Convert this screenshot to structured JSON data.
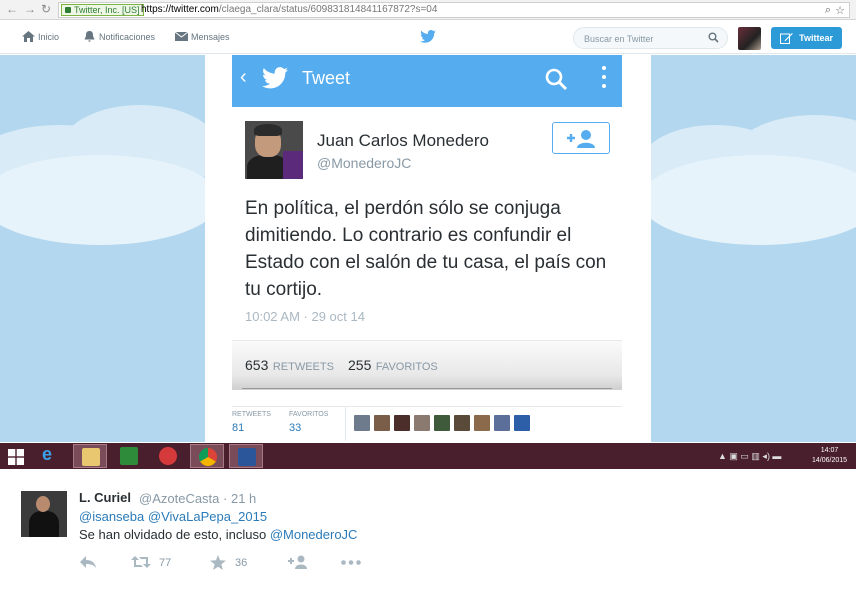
{
  "browser": {
    "secure_label": "Twitter, Inc. [US]",
    "url_host": "https://twitter.com",
    "url_path": "/claega_clara/status/609831814841167872?s=04"
  },
  "topnav": {
    "home": "Inicio",
    "notifications": "Notificaciones",
    "messages": "Mensajes",
    "search_placeholder": "Buscar en Twitter",
    "tweet_button": "Twittear"
  },
  "tweet_view": {
    "header_title": "Tweet",
    "author_name": "Juan Carlos Monedero",
    "author_handle": "@MonederoJC",
    "text": "En política, el perdón sólo se conjuga dimitiendo. Lo contrario es confundir el Estado con el salón de tu casa, el país con tu cortijo.",
    "timestamp": "10:02 AM · 29 oct 14",
    "retweets_count": "653",
    "retweets_label": "RETWEETS",
    "favorites_count": "255",
    "favorites_label": "FAVORITOS",
    "mini_retweets_label": "RETWEETS",
    "mini_retweets_count": "81",
    "mini_favorites_label": "FAVORITOS",
    "mini_favorites_count": "33"
  },
  "taskbar": {
    "time": "14:07",
    "date": "14/06/2015"
  },
  "reply": {
    "name": "L. Curiel",
    "handle": "@AzoteCasta",
    "age": "· 21 h",
    "mention1": "@isanseba",
    "mention2": "@VivaLaPepa_2015",
    "text": "Se han olvidado de esto, incluso ",
    "mention3": "@MonederoJC",
    "retweet_count": "77",
    "favorite_count": "36"
  },
  "colors": {
    "twitter_blue": "#55acee",
    "button_blue": "#2b9ad7",
    "taskbar": "#4a1f2d"
  }
}
